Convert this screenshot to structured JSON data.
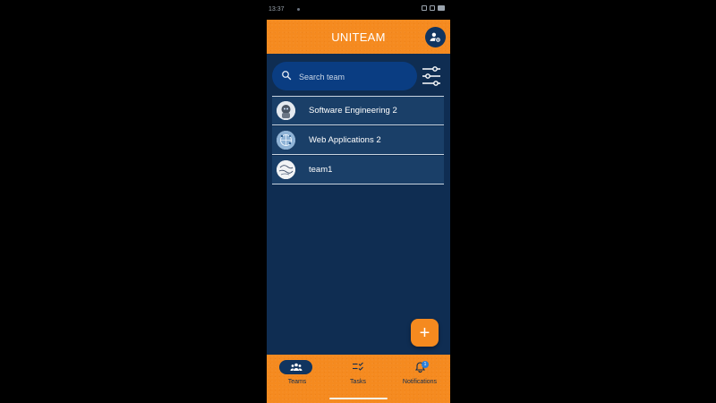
{
  "status_bar": {
    "time": "13:37"
  },
  "app_bar": {
    "title": "UNITEAM"
  },
  "search": {
    "placeholder": "Search team"
  },
  "teams": [
    {
      "name": "Software Engineering 2",
      "avatar": "robot-avatar"
    },
    {
      "name": "Web Applications 2",
      "avatar": "network-avatar"
    },
    {
      "name": "team1",
      "avatar": "sketch-avatar"
    }
  ],
  "fab": {
    "label": "+"
  },
  "bottom_nav": {
    "items": [
      {
        "label": "Teams",
        "icon": "groups-icon",
        "selected": true
      },
      {
        "label": "Tasks",
        "icon": "task-list-icon",
        "selected": false
      },
      {
        "label": "Notifications",
        "icon": "bell-icon",
        "selected": false,
        "badge": "1"
      }
    ]
  },
  "colors": {
    "background": "#0f2d52",
    "accent": "#f58a1f",
    "list_row": "#1a3f68",
    "search_bg": "#0a3d82",
    "badge": "#2b7fd8"
  }
}
